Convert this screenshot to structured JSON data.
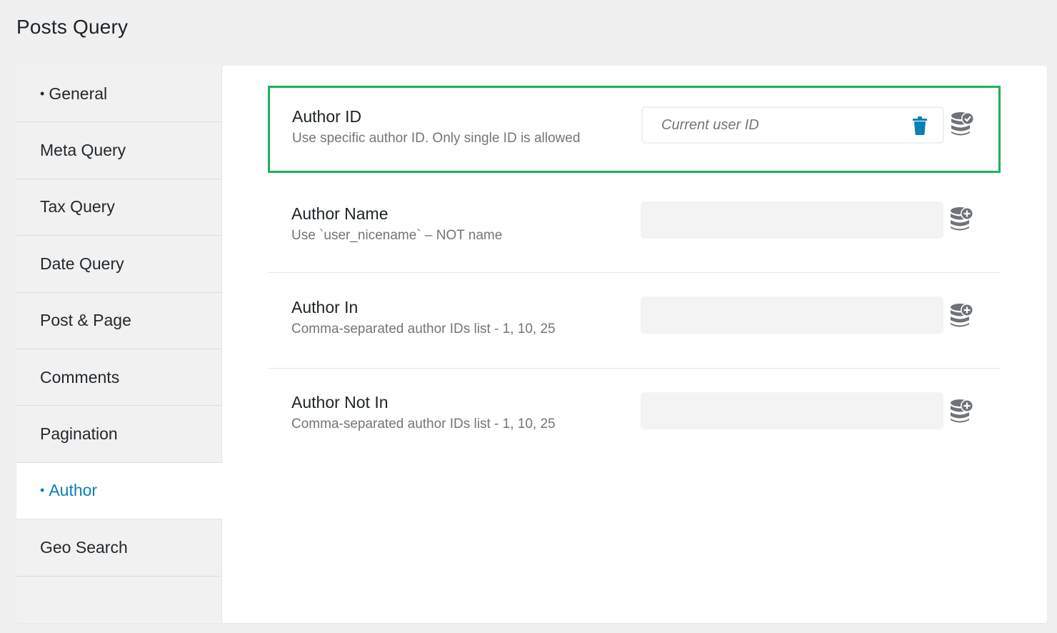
{
  "page": {
    "title": "Posts Query"
  },
  "sidebar": {
    "items": [
      {
        "label": "General",
        "dot": "•",
        "active": false
      },
      {
        "label": "Meta Query",
        "dot": "",
        "active": false
      },
      {
        "label": "Tax Query",
        "dot": "",
        "active": false
      },
      {
        "label": "Date Query",
        "dot": "",
        "active": false
      },
      {
        "label": "Post & Page",
        "dot": "",
        "active": false
      },
      {
        "label": "Comments",
        "dot": "",
        "active": false
      },
      {
        "label": "Pagination",
        "dot": "",
        "active": false
      },
      {
        "label": "Author",
        "dot": "•",
        "active": true
      },
      {
        "label": "Geo Search",
        "dot": "",
        "active": false
      }
    ]
  },
  "fields": [
    {
      "title": "Author ID",
      "description": "Use specific author ID. Only single ID is allowed",
      "value": "Current user ID",
      "dynamic_icon": "database-check-icon",
      "clear_icon": "trash-icon"
    },
    {
      "title": "Author Name",
      "description": "Use `user_nicename` – NOT name",
      "value": "",
      "dynamic_icon": "database-plus-icon"
    },
    {
      "title": "Author In",
      "description": "Comma-separated author IDs list - 1, 10, 25",
      "value": "",
      "dynamic_icon": "database-plus-icon"
    },
    {
      "title": "Author Not In",
      "description": "Comma-separated author IDs list - 1, 10, 25",
      "value": "",
      "dynamic_icon": "database-plus-icon"
    }
  ],
  "colors": {
    "accent": "#0a7fb5",
    "highlight_border": "#1fb25a",
    "page_bg": "#f0f0f1",
    "icon_gray": "#6f7377"
  }
}
